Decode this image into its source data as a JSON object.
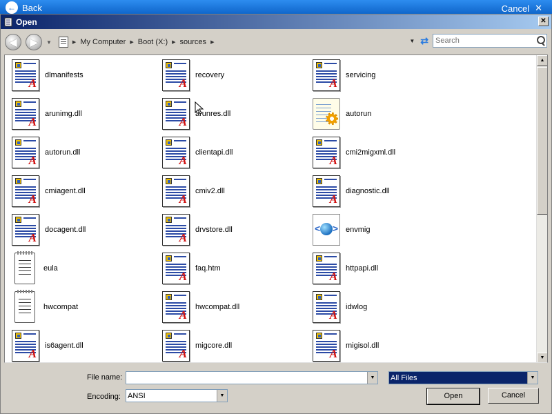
{
  "background": {
    "back_label": "Back",
    "cancel_label": "Cancel"
  },
  "dialog": {
    "title": "Open"
  },
  "toolbar": {
    "breadcrumb": [
      "My Computer",
      "Boot (X:)",
      "sources"
    ],
    "search_placeholder": "Search"
  },
  "files": [
    {
      "name": "dlmanifests",
      "icon": "dll-file-icon"
    },
    {
      "name": "recovery",
      "icon": "dll-file-icon"
    },
    {
      "name": "servicing",
      "icon": "dll-file-icon"
    },
    {
      "name": "arunimg.dll",
      "icon": "dll-file-icon"
    },
    {
      "name": "arunres.dll",
      "icon": "dll-file-icon"
    },
    {
      "name": "autorun",
      "icon": "autorun-icon"
    },
    {
      "name": "autorun.dll",
      "icon": "dll-file-icon"
    },
    {
      "name": "clientapi.dll",
      "icon": "dll-file-icon"
    },
    {
      "name": "cmi2migxml.dll",
      "icon": "dll-file-icon"
    },
    {
      "name": "cmiagent.dll",
      "icon": "dll-file-icon"
    },
    {
      "name": "cmiv2.dll",
      "icon": "dll-file-icon"
    },
    {
      "name": "diagnostic.dll",
      "icon": "dll-file-icon"
    },
    {
      "name": "docagent.dll",
      "icon": "dll-file-icon"
    },
    {
      "name": "drvstore.dll",
      "icon": "dll-file-icon"
    },
    {
      "name": "envmig",
      "icon": "xml-file-icon"
    },
    {
      "name": "eula",
      "icon": "text-file-icon"
    },
    {
      "name": "faq.htm",
      "icon": "dll-file-icon"
    },
    {
      "name": "httpapi.dll",
      "icon": "dll-file-icon"
    },
    {
      "name": "hwcompat",
      "icon": "text-file-icon"
    },
    {
      "name": "hwcompat.dll",
      "icon": "dll-file-icon"
    },
    {
      "name": "idwlog",
      "icon": "dll-file-icon"
    },
    {
      "name": "is6agent.dll",
      "icon": "dll-file-icon"
    },
    {
      "name": "migcore.dll",
      "icon": "dll-file-icon"
    },
    {
      "name": "migisol.dll",
      "icon": "dll-file-icon"
    }
  ],
  "bottom": {
    "filename_label": "File name:",
    "filename_value": "",
    "filetype_value": "All Files",
    "encoding_label": "Encoding:",
    "encoding_value": "ANSI",
    "open_label": "Open",
    "cancel_label": "Cancel"
  },
  "colors": {
    "selection": "#0a246a",
    "dll_accent": "#d01010"
  }
}
